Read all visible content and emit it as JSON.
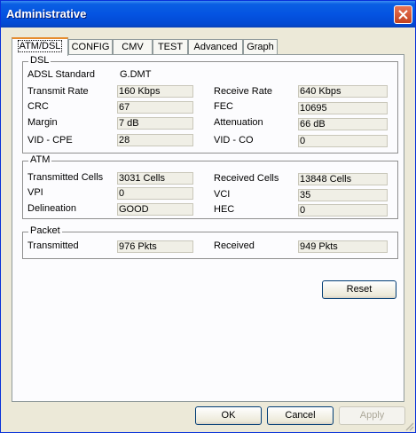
{
  "window": {
    "title": "Administrative"
  },
  "tabs": [
    "ATM/DSL",
    "CONFIG",
    "CMV",
    "TEST",
    "Advanced",
    "Graph"
  ],
  "dsl": {
    "group_label": "DSL",
    "adsl_standard_label": "ADSL Standard",
    "adsl_standard_value": "G.DMT",
    "transmit_rate_label": "Transmit Rate",
    "transmit_rate_value": "160 Kbps",
    "receive_rate_label": "Receive Rate",
    "receive_rate_value": "640 Kbps",
    "crc_label": "CRC",
    "crc_value": "67",
    "fec_label": "FEC",
    "fec_value": "10695",
    "margin_label": "Margin",
    "margin_value": "7 dB",
    "attenuation_label": "Attenuation",
    "attenuation_value": "66 dB",
    "vid_cpe_label": "VID - CPE",
    "vid_cpe_value": "28",
    "vid_co_label": "VID - CO",
    "vid_co_value": "0"
  },
  "atm": {
    "group_label": "ATM",
    "transmitted_cells_label": "Transmitted Cells",
    "transmitted_cells_value": "3031 Cells",
    "received_cells_label": "Received Cells",
    "received_cells_value": "13848 Cells",
    "vpi_label": "VPI",
    "vpi_value": "0",
    "vci_label": "VCI",
    "vci_value": "35",
    "delineation_label": "Delineation",
    "delineation_value": "GOOD",
    "hec_label": "HEC",
    "hec_value": "0"
  },
  "packet": {
    "group_label": "Packet",
    "transmitted_label": "Transmitted",
    "transmitted_value": "976 Pkts",
    "received_label": "Received",
    "received_value": "949 Pkts"
  },
  "buttons": {
    "reset": "Reset",
    "ok": "OK",
    "cancel": "Cancel",
    "apply": "Apply"
  }
}
